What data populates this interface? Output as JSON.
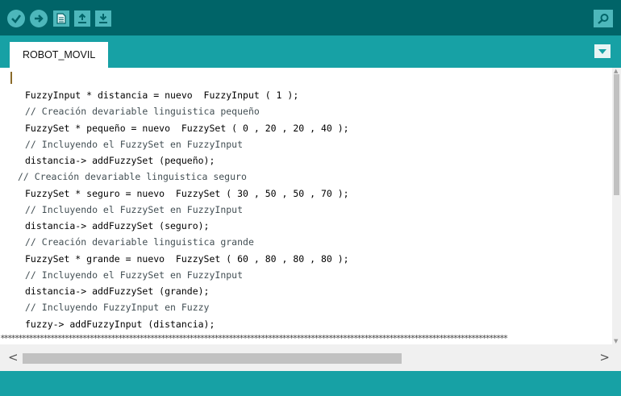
{
  "toolbar": {
    "buttons": [
      {
        "name": "verify-button",
        "icon": "checkmark-icon"
      },
      {
        "name": "upload-button",
        "icon": "arrow-right-icon"
      },
      {
        "name": "new-button",
        "icon": "document-icon"
      },
      {
        "name": "open-button",
        "icon": "arrow-up-icon"
      },
      {
        "name": "save-button",
        "icon": "arrow-down-icon"
      }
    ],
    "serial_monitor_icon": "magnifier-icon"
  },
  "tabs": [
    {
      "label": "ROBOT_MOVIL"
    }
  ],
  "tab_menu_icon": "triangle-down-icon",
  "editor": {
    "lines": [
      "FuzzyInput * distancia = nuevo  FuzzyInput ( 1 );",
      "// Creación devariable linguistica pequeño",
      "FuzzySet * pequeño = nuevo  FuzzySet ( 0 , 20 , 20 , 40 );",
      "// Incluyendo el FuzzySet en FuzzyInput",
      "distancia-> addFuzzySet (pequeño);",
      "// Creación devariable linguistica seguro",
      "FuzzySet * seguro = nuevo  FuzzySet ( 30 , 50 , 50 , 70 );",
      "// Incluyendo el FuzzySet en FuzzyInput",
      "distancia-> addFuzzySet (seguro);",
      "// Creación devariable linguistica grande",
      "FuzzySet * grande = nuevo  FuzzySet ( 60 , 80 , 80 , 80 );",
      "// Incluyendo el FuzzySet en FuzzyInput",
      "distancia-> addFuzzySet (grande);",
      "// Incluyendo FuzzyInput en Fuzzy",
      "fuzzy-> addFuzzyInput (distancia);"
    ],
    "separator": "**********************************************************************************************************************************************"
  },
  "scroll": {
    "left_arrow": "<",
    "right_arrow": ">"
  },
  "colors": {
    "toolbar": "#006468",
    "tabbar": "#17a1a5",
    "button": "#4db7bb"
  }
}
